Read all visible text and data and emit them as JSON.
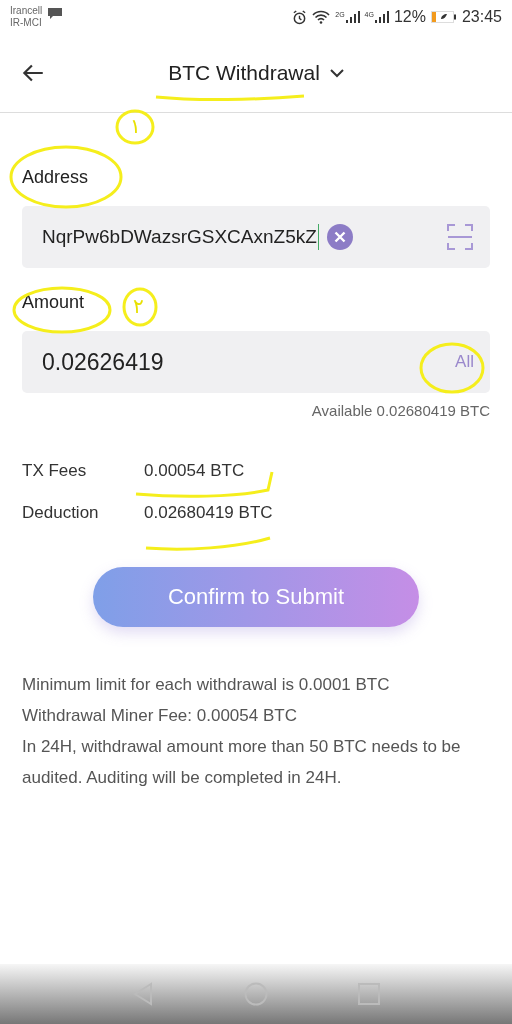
{
  "status_bar": {
    "carriers": [
      "Irancell",
      "IR-MCI"
    ],
    "sim_labels": [
      "2G",
      "4G"
    ],
    "battery_percent": "12%",
    "time": "23:45"
  },
  "header": {
    "title": "BTC Withdrawal"
  },
  "address": {
    "label": "Address",
    "value": "NqrPw6bDWazsrGSXCAxnZ5kZ"
  },
  "amount": {
    "label": "Amount",
    "value": "0.02626419",
    "all_button": "All",
    "available": "Available 0.02680419 BTC"
  },
  "fees": [
    {
      "label": "TX Fees",
      "value": "0.00054 BTC"
    },
    {
      "label": "Deduction",
      "value": "0.02680419 BTC"
    }
  ],
  "submit_button": "Confirm to Submit",
  "notes": [
    "Minimum limit for each withdrawal is 0.0001 BTC",
    "Withdrawal Miner Fee: 0.00054 BTC",
    "In 24H, withdrawal amount more than 50 BTC needs to be audited. Auditing will be completed in 24H."
  ],
  "annotations": {
    "numbers": [
      "١",
      "٢"
    ]
  }
}
